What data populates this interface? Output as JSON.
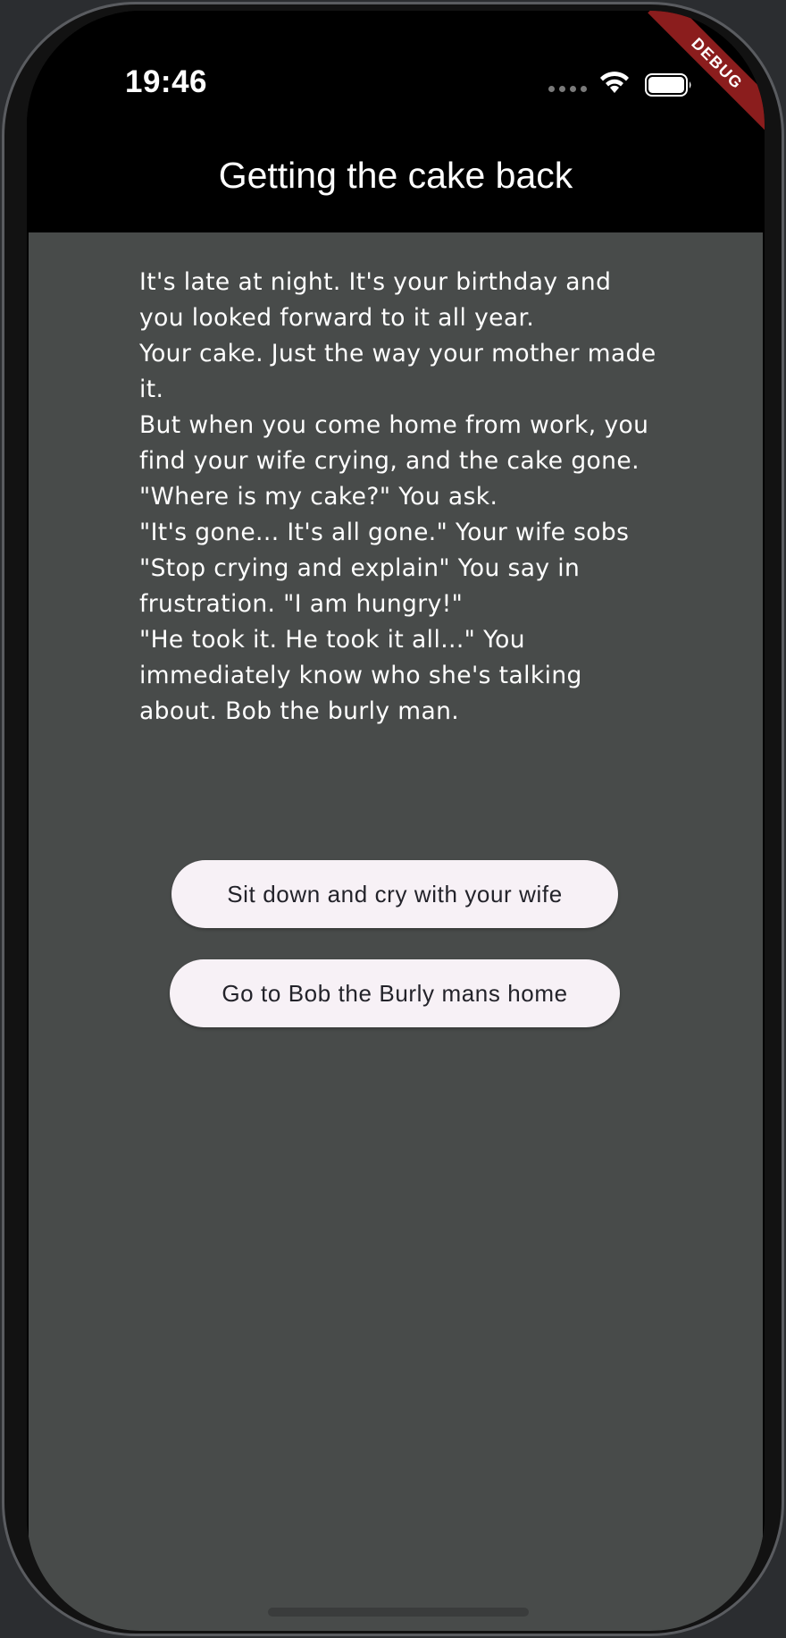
{
  "status_bar": {
    "time": "19:46"
  },
  "debug_banner": "DEBUG",
  "app_bar": {
    "title": "Getting the cake back"
  },
  "story": {
    "text": "It's late at night. It's your birthday and you looked forward to it all year.\nYour cake. Just the way your mother made it.\nBut when you come home from work, you find your wife crying, and the cake gone.\n\"Where is my cake?\" You ask.\n\"It's gone... It's all gone.\" Your wife sobs\n\"Stop crying and explain\" You say in frustration. \"I am hungry!\"\n\"He took it. He took it all...\" You immediately know who she's talking about. Bob the burly man."
  },
  "choices": [
    {
      "label": "Sit down and cry with your wife"
    },
    {
      "label": "Go to Bob the Burly mans home"
    }
  ],
  "colors": {
    "body_background": "#484b4a",
    "app_bar_background": "#000000",
    "button_background": "#f7f1f6",
    "debug_banner": "#8b1d1d"
  }
}
